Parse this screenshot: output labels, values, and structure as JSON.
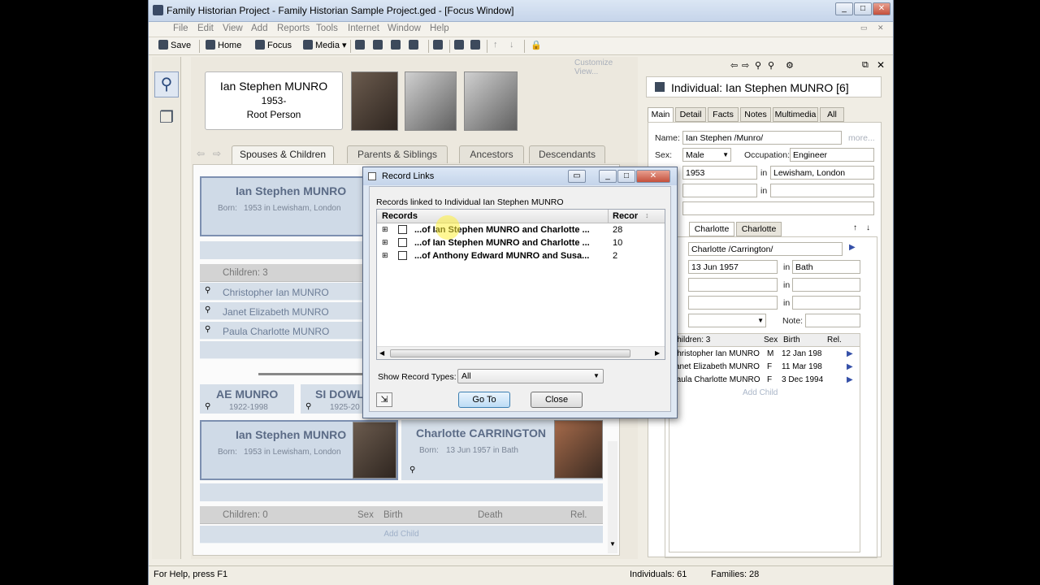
{
  "window": {
    "title": "Family Historian Project - Family Historian Sample Project.ged - [Focus Window]",
    "app_icon": "app-icon"
  },
  "menu": [
    "File",
    "Edit",
    "View",
    "Add",
    "Reports",
    "Tools",
    "Internet",
    "Window",
    "Help"
  ],
  "toolbar": {
    "save": "Save",
    "home": "Home",
    "focus": "Focus",
    "media": "Media"
  },
  "focus": {
    "customize": "Customize View...",
    "root": {
      "name": "Ian Stephen MUNRO",
      "dates": "1953-",
      "role": "Root Person"
    },
    "tabs": [
      "Spouses & Children",
      "Parents & Siblings",
      "Ancestors",
      "Descendants"
    ],
    "top_person": {
      "name": "Ian Stephen MUNRO",
      "born_label": "Born:",
      "born": "1953 in Lewisham, London"
    },
    "children_header": "Children: 3",
    "children": [
      "Christopher Ian MUNRO",
      "Janet Elizabeth MUNRO",
      "Paula Charlotte MUNRO"
    ],
    "parents": [
      {
        "name": "AE MUNRO",
        "dates": "1922-1998"
      },
      {
        "name": "SI DOWL",
        "dates": "1925-20"
      }
    ],
    "bottom_person": {
      "name": "Ian Stephen MUNRO",
      "born_label": "Born:",
      "born": "1953 in Lewisham, London"
    },
    "spouse": {
      "name": "Charlotte CARRINGTON",
      "born_label": "Born:",
      "born": "13 Jun 1957 in Bath"
    },
    "children2_header": "Children: 0",
    "children2_cols": [
      "Sex",
      "Birth",
      "Death",
      "Rel."
    ],
    "add_child": "Add Child"
  },
  "dialog": {
    "title": "Record Links",
    "subtitle": "Records linked to Individual Ian Stephen MUNRO",
    "col_records": "Records",
    "col_count": "Recor",
    "rows": [
      {
        "label": "...of Ian Stephen MUNRO and Charlotte ...",
        "count": "28"
      },
      {
        "label": "...of Ian Stephen MUNRO and Charlotte ...",
        "count": "10"
      },
      {
        "label": "...of Anthony Edward MUNRO and Susa...",
        "count": "2"
      }
    ],
    "show_label": "Show Record Types:",
    "show_value": "All",
    "goto": "Go To",
    "close": "Close"
  },
  "props": {
    "header": "Individual: Ian Stephen MUNRO [6]",
    "tabs": [
      "Main",
      "Detail",
      "Facts",
      "Notes",
      "Multimedia",
      "All"
    ],
    "name_label": "Name:",
    "name": "Ian Stephen /Munro/",
    "more": "more...",
    "sex_label": "Sex:",
    "sex": "Male",
    "occ_label": "Occupation:",
    "occupation": "Engineer",
    "birth": "1953",
    "in1": "in",
    "birth_place": "Lewisham, London",
    "in2": "in",
    "spouse_tabs": [
      "Charlotte",
      "Charlotte"
    ],
    "spouse_name": "Charlotte /Carrington/",
    "sp_birth": "13 Jun 1957",
    "in3": "in",
    "sp_place": "Bath",
    "in4": "in",
    "in5": "in",
    "note_label": "Note:",
    "children_header": "Children: 3",
    "ch_cols": [
      "Sex",
      "Birth",
      "Rel."
    ],
    "children": [
      {
        "name": "Christopher Ian MUNRO",
        "sex": "M",
        "birth": "12 Jan 198"
      },
      {
        "name": "Janet Elizabeth MUNRO",
        "sex": "F",
        "birth": "11 Mar 198"
      },
      {
        "name": "Paula Charlotte MUNRO",
        "sex": "F",
        "birth": "3 Dec 1994"
      }
    ],
    "add_child": "Add Child"
  },
  "status": {
    "help": "For Help, press F1",
    "individuals": "Individuals: 61",
    "families": "Families: 28"
  }
}
